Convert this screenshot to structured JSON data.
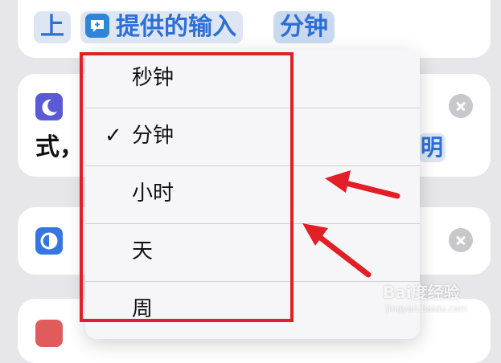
{
  "top_row": {
    "up_token": "上",
    "input_token": "提供的输入",
    "unit_token": "分钟"
  },
  "cards": {
    "card2_partial_text": "式，",
    "card2_partial_right": "明"
  },
  "menu": {
    "items": [
      {
        "label": "秒钟",
        "checked": false
      },
      {
        "label": "分钟",
        "checked": true
      },
      {
        "label": "小时",
        "checked": false
      },
      {
        "label": "天",
        "checked": false
      },
      {
        "label": "周",
        "checked": false
      }
    ],
    "check_glyph": "✓"
  },
  "annotation": {
    "highlight_color": "#e01f26",
    "arrow_color": "#e01f26"
  },
  "watermark": {
    "brand": "Bai度经验",
    "url": "jingyan.baidu.com"
  },
  "colors": {
    "accent_blue": "#2c6fd6",
    "token_bg": "#dde6f2",
    "background": "#e6e6eb"
  }
}
